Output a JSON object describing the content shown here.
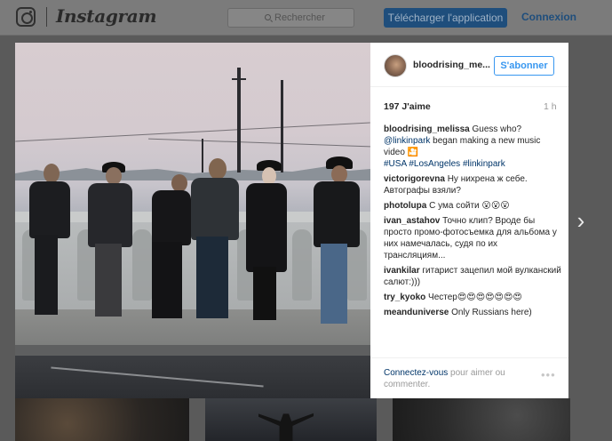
{
  "topbar": {
    "brand": "Instagram",
    "search_placeholder": "Rechercher",
    "download_label": "Télécharger l'application",
    "login_label": "Connexion"
  },
  "post": {
    "username": "bloodrising_me...",
    "follow_label": "S'abonner",
    "likes": "197 J'aime",
    "time": "1 h",
    "caption": {
      "user": "bloodrising_melissa",
      "text_1": " Guess who? ",
      "mention": "@linkinpark",
      "text_2": " began making a new music video 🎦",
      "hashtags": "#USA #LosAngeles #linkinpark"
    },
    "comments": [
      {
        "user": "victorigorevna",
        "text": " Ну нихрена ж себе. Автографы взяли?"
      },
      {
        "user": "photolupa",
        "text": " С ума сойти 😮😮😮"
      },
      {
        "user": "ivan_astahov",
        "text": " Точно клип? Вроде бы просто промо-фотосъемка для альбома у них намечалась, судя по их трансляциям..."
      },
      {
        "user": "ivankilar",
        "text": " гитарист зацепил мой вулканский салют:)))"
      },
      {
        "user": "try_kyoko",
        "text": " Честер😍😍😍😍😍😍😍"
      },
      {
        "user": "meanduniverse",
        "text": " Only Russians here)"
      }
    ],
    "login_prompt_link": "Connectez-vous",
    "login_prompt_text": " pour aimer ou commenter.",
    "more_icon": "•••"
  },
  "navigation": {
    "next_icon": "›"
  }
}
